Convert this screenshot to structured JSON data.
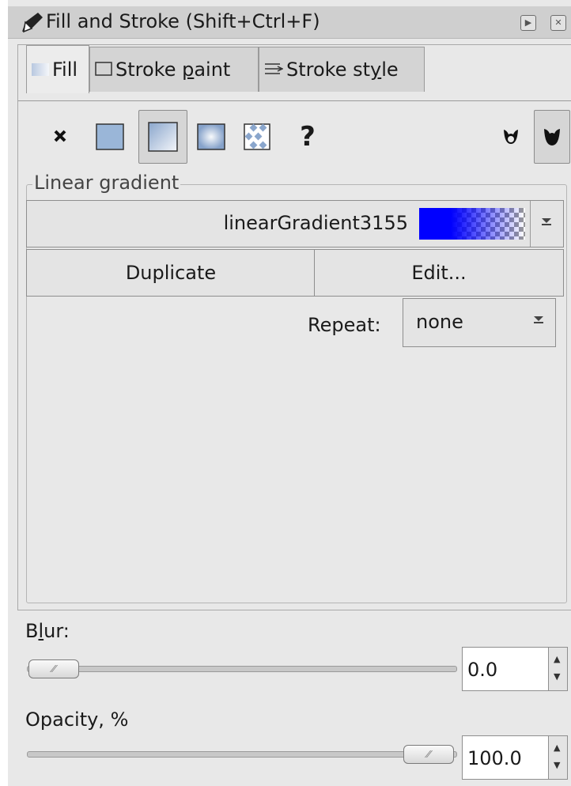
{
  "title": "Fill and Stroke (Shift+Ctrl+F)",
  "tabs": [
    {
      "label": "Fill",
      "icon": "fill-icon",
      "active": true
    },
    {
      "label": "Stroke paint",
      "icon": "stroke-paint-icon",
      "active": false
    },
    {
      "label": "Stroke style",
      "icon": "stroke-style-icon",
      "active": false
    }
  ],
  "paint_modes": [
    "no-paint",
    "flat-color",
    "linear-gradient",
    "radial-gradient",
    "pattern",
    "unset"
  ],
  "paint_modes_unset_glyph": "?",
  "fill_rule": [
    "evenodd",
    "nonzero"
  ],
  "gradient": {
    "legend": "Linear gradient",
    "name": "linearGradient3155",
    "duplicate_label": "Duplicate",
    "edit_label": "Edit...",
    "repeat_label": "Repeat:",
    "repeat_value": "none"
  },
  "blur": {
    "label": "Blur:",
    "value": "0.0"
  },
  "opacity": {
    "label": "Opacity, %",
    "value": "100.0"
  },
  "colors": {
    "gradient_stop": "#0000ff",
    "panel_bg": "#e8e8e8"
  }
}
